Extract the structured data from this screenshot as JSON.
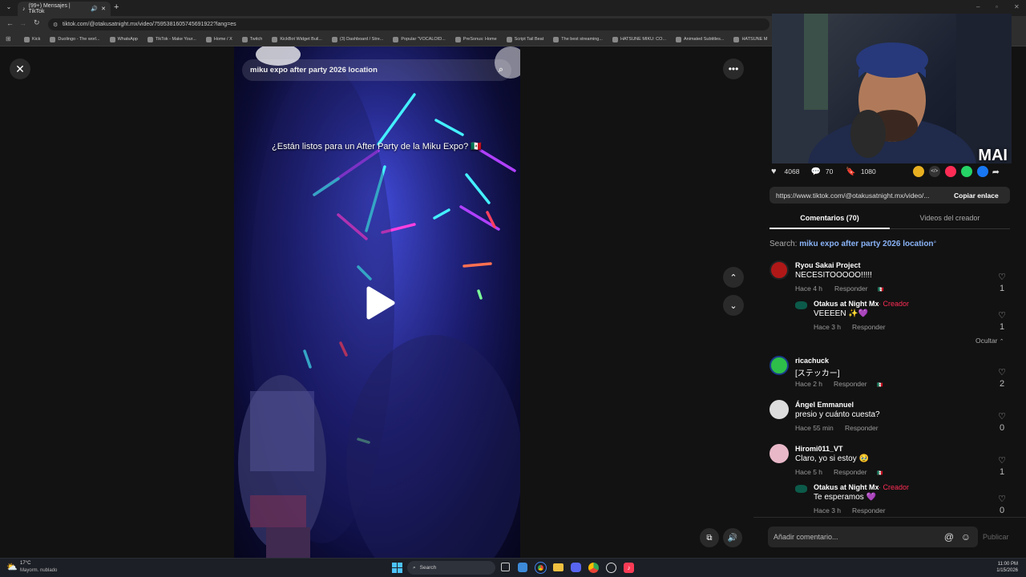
{
  "browser": {
    "tab_title": "(99+) Mensajes | TikTok",
    "url": "tiktok.com/@otakusatnight.mx/video/7595381605745691922?lang=es",
    "bookmarks": [
      "Kick",
      "Duolingo - The worl...",
      "WhatsApp",
      "TikTok - Make Your...",
      "Home / X",
      "Twitch",
      "KickBot Widget Buil...",
      "(3) Dashboard / Stre...",
      "Popular \"VOCALOID...",
      "PreSonus: Home",
      "Script Tail Beat",
      "The best streaming...",
      "HATSUNE MIKU: CO...",
      "Animated Subtitles...",
      "HATSUNE M"
    ]
  },
  "video": {
    "search_text": "miku expo after party 2026 location",
    "caption": "¿Están listos para un After Party de la Miku Expo? 🇲🇽"
  },
  "webcam": {
    "overlay_text": "MAI"
  },
  "stats": {
    "likes": "4068",
    "comments": "70",
    "saves": "1080"
  },
  "link": {
    "url": "https://www.tiktok.com/@otakusatnight.mx/video/...",
    "copy_label": "Copiar enlace"
  },
  "tabs": {
    "comments": "Comentarios (70)",
    "creator_videos": "Videos del creador"
  },
  "search_suggest": {
    "prefix": "Search:",
    "query": "miku expo after party 2026 location"
  },
  "comments": [
    {
      "user": "Ryou Sakai Project",
      "text": "NECESITOOOOO!!!!!",
      "time": "Hace 4 h",
      "reply": "Responder",
      "likes": "1"
    },
    {
      "user": "Otakus at Night Mx",
      "badge": "· Creador",
      "text": "VEEEEN ✨💜",
      "time": "Hace 3 h",
      "reply": "Responder",
      "likes": "1"
    },
    {
      "user": "ricachuck",
      "text": "[ステッカー]",
      "time": "Hace 2 h",
      "reply": "Responder",
      "likes": "2"
    },
    {
      "user": "Ángel Emmanuel",
      "text": "presio y cuánto cuesta?",
      "time": "Hace 55 min",
      "reply": "Responder",
      "likes": "0"
    },
    {
      "user": "Hiromi011_VT",
      "text": "Claro, yo si estoy 🥹",
      "time": "Hace 5 h",
      "reply": "Responder",
      "likes": "1"
    },
    {
      "user": "Otakus at Night Mx",
      "badge": "· Creador",
      "text": "Te esperamos 💜",
      "time": "Hace 3 h",
      "reply": "Responder",
      "likes": "0"
    }
  ],
  "hide_label": "Ocultar",
  "compose": {
    "placeholder": "Añadir comentario...",
    "publish": "Publicar"
  },
  "taskbar": {
    "weather_temp": "17°C",
    "weather_desc": "Mayorm. nublado",
    "search": "Search",
    "time": "11:00 PM",
    "date": "1/15/2026"
  },
  "colors": {
    "creator": "#fe2c55",
    "link": "#8ab4f8",
    "accent": "#fe2c55"
  }
}
